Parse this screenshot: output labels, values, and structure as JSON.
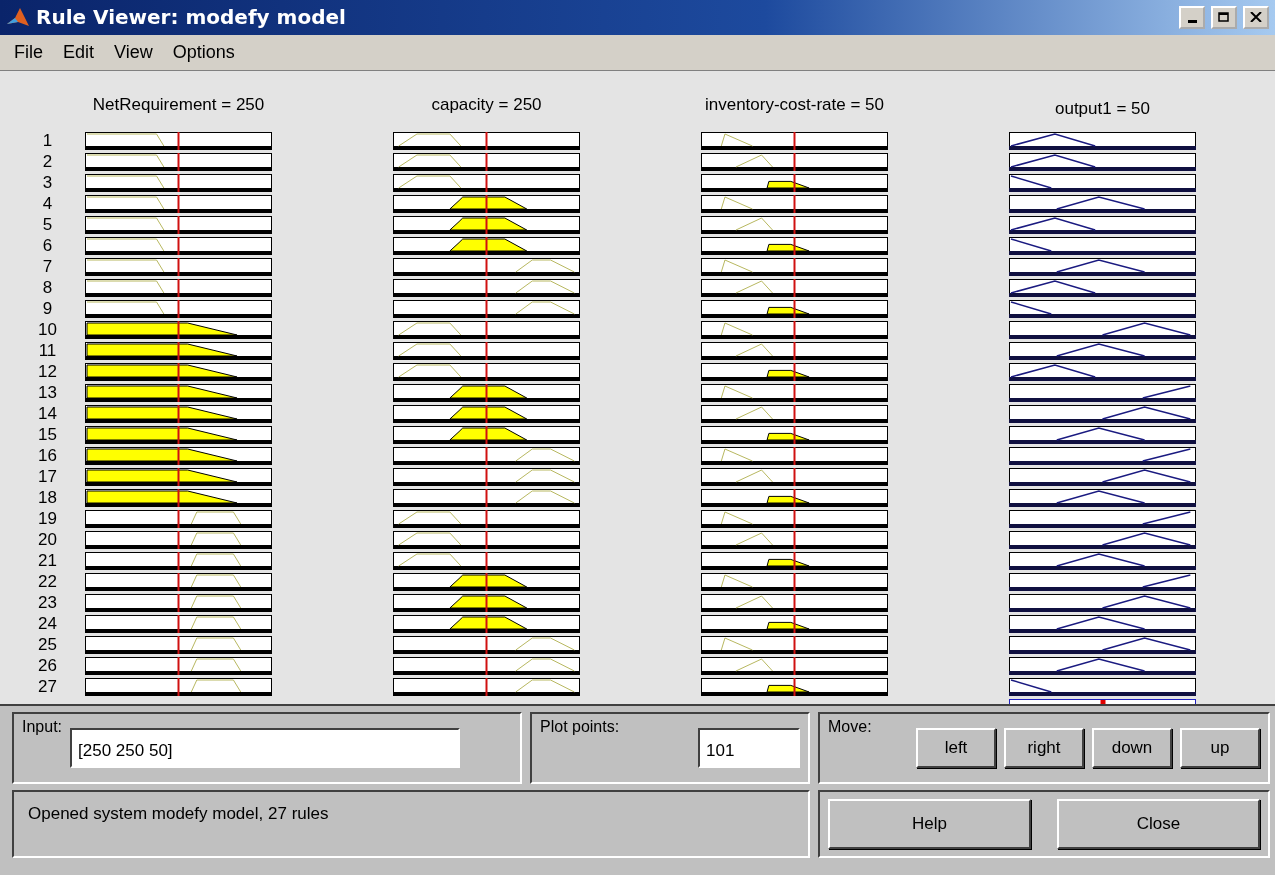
{
  "window": {
    "title": "Rule Viewer: modefy model"
  },
  "menu": [
    "File",
    "Edit",
    "View",
    "Options"
  ],
  "variables": [
    {
      "label": "NetRequirement = 250",
      "kind": "input"
    },
    {
      "label": "capacity = 250",
      "kind": "input"
    },
    {
      "label": "inventory-cost-rate = 50",
      "kind": "input"
    },
    {
      "label": "output1 = 50",
      "kind": "output"
    }
  ],
  "rules": [
    {
      "number": "1",
      "cells": [
        {
          "kind": "low",
          "fired": false
        },
        {
          "kind": "low",
          "fired": false
        },
        {
          "kind": "low",
          "fired": false
        },
        {
          "kind": "low"
        }
      ]
    },
    {
      "number": "2",
      "cells": [
        {
          "kind": "low",
          "fired": false
        },
        {
          "kind": "low",
          "fired": false
        },
        {
          "kind": "mid",
          "fired": false
        },
        {
          "kind": "low"
        }
      ]
    },
    {
      "number": "3",
      "cells": [
        {
          "kind": "low",
          "fired": false
        },
        {
          "kind": "low",
          "fired": false
        },
        {
          "kind": "high",
          "fired": true
        },
        {
          "kind": "vlow"
        }
      ]
    },
    {
      "number": "4",
      "cells": [
        {
          "kind": "low",
          "fired": false
        },
        {
          "kind": "mid",
          "fired": true
        },
        {
          "kind": "low",
          "fired": false
        },
        {
          "kind": "mid"
        }
      ]
    },
    {
      "number": "5",
      "cells": [
        {
          "kind": "low",
          "fired": false
        },
        {
          "kind": "mid",
          "fired": true
        },
        {
          "kind": "mid",
          "fired": false
        },
        {
          "kind": "low"
        }
      ]
    },
    {
      "number": "6",
      "cells": [
        {
          "kind": "low",
          "fired": false
        },
        {
          "kind": "mid",
          "fired": true
        },
        {
          "kind": "high",
          "fired": true
        },
        {
          "kind": "vlow"
        }
      ]
    },
    {
      "number": "7",
      "cells": [
        {
          "kind": "low",
          "fired": false
        },
        {
          "kind": "high",
          "fired": false
        },
        {
          "kind": "low",
          "fired": false
        },
        {
          "kind": "mid"
        }
      ]
    },
    {
      "number": "8",
      "cells": [
        {
          "kind": "low",
          "fired": false
        },
        {
          "kind": "high",
          "fired": false
        },
        {
          "kind": "mid",
          "fired": false
        },
        {
          "kind": "low"
        }
      ]
    },
    {
      "number": "9",
      "cells": [
        {
          "kind": "low",
          "fired": false
        },
        {
          "kind": "high",
          "fired": false
        },
        {
          "kind": "high",
          "fired": true
        },
        {
          "kind": "vlow"
        }
      ]
    },
    {
      "number": "10",
      "cells": [
        {
          "kind": "mid",
          "fired": true
        },
        {
          "kind": "low",
          "fired": false
        },
        {
          "kind": "low",
          "fired": false
        },
        {
          "kind": "high"
        }
      ]
    },
    {
      "number": "11",
      "cells": [
        {
          "kind": "mid",
          "fired": true
        },
        {
          "kind": "low",
          "fired": false
        },
        {
          "kind": "mid",
          "fired": false
        },
        {
          "kind": "mid"
        }
      ]
    },
    {
      "number": "12",
      "cells": [
        {
          "kind": "mid",
          "fired": true
        },
        {
          "kind": "low",
          "fired": false
        },
        {
          "kind": "high",
          "fired": true
        },
        {
          "kind": "low"
        }
      ]
    },
    {
      "number": "13",
      "cells": [
        {
          "kind": "mid",
          "fired": true
        },
        {
          "kind": "mid",
          "fired": true
        },
        {
          "kind": "low",
          "fired": false
        },
        {
          "kind": "vhigh"
        }
      ]
    },
    {
      "number": "14",
      "cells": [
        {
          "kind": "mid",
          "fired": true
        },
        {
          "kind": "mid",
          "fired": true
        },
        {
          "kind": "mid",
          "fired": false
        },
        {
          "kind": "high"
        }
      ]
    },
    {
      "number": "15",
      "cells": [
        {
          "kind": "mid",
          "fired": true
        },
        {
          "kind": "mid",
          "fired": true
        },
        {
          "kind": "high",
          "fired": true
        },
        {
          "kind": "mid"
        }
      ]
    },
    {
      "number": "16",
      "cells": [
        {
          "kind": "mid",
          "fired": true
        },
        {
          "kind": "high",
          "fired": false
        },
        {
          "kind": "low",
          "fired": false
        },
        {
          "kind": "vhigh"
        }
      ]
    },
    {
      "number": "17",
      "cells": [
        {
          "kind": "mid",
          "fired": true
        },
        {
          "kind": "high",
          "fired": false
        },
        {
          "kind": "mid",
          "fired": false
        },
        {
          "kind": "high"
        }
      ]
    },
    {
      "number": "18",
      "cells": [
        {
          "kind": "mid",
          "fired": true
        },
        {
          "kind": "high",
          "fired": false
        },
        {
          "kind": "high",
          "fired": true
        },
        {
          "kind": "mid"
        }
      ]
    },
    {
      "number": "19",
      "cells": [
        {
          "kind": "high",
          "fired": false
        },
        {
          "kind": "low",
          "fired": false
        },
        {
          "kind": "low",
          "fired": false
        },
        {
          "kind": "vhigh"
        }
      ]
    },
    {
      "number": "20",
      "cells": [
        {
          "kind": "high",
          "fired": false
        },
        {
          "kind": "low",
          "fired": false
        },
        {
          "kind": "mid",
          "fired": false
        },
        {
          "kind": "high"
        }
      ]
    },
    {
      "number": "21",
      "cells": [
        {
          "kind": "high",
          "fired": false
        },
        {
          "kind": "low",
          "fired": false
        },
        {
          "kind": "high",
          "fired": true
        },
        {
          "kind": "mid"
        }
      ]
    },
    {
      "number": "22",
      "cells": [
        {
          "kind": "high",
          "fired": false
        },
        {
          "kind": "mid",
          "fired": true
        },
        {
          "kind": "low",
          "fired": false
        },
        {
          "kind": "vhigh"
        }
      ]
    },
    {
      "number": "23",
      "cells": [
        {
          "kind": "high",
          "fired": false
        },
        {
          "kind": "mid",
          "fired": true
        },
        {
          "kind": "mid",
          "fired": false
        },
        {
          "kind": "high"
        }
      ]
    },
    {
      "number": "24",
      "cells": [
        {
          "kind": "high",
          "fired": false
        },
        {
          "kind": "mid",
          "fired": true
        },
        {
          "kind": "high",
          "fired": true
        },
        {
          "kind": "mid"
        }
      ]
    },
    {
      "number": "25",
      "cells": [
        {
          "kind": "high",
          "fired": false
        },
        {
          "kind": "high",
          "fired": false
        },
        {
          "kind": "low",
          "fired": false
        },
        {
          "kind": "high"
        }
      ]
    },
    {
      "number": "26",
      "cells": [
        {
          "kind": "high",
          "fired": false
        },
        {
          "kind": "high",
          "fired": false
        },
        {
          "kind": "mid",
          "fired": false
        },
        {
          "kind": "mid"
        }
      ]
    },
    {
      "number": "27",
      "cells": [
        {
          "kind": "high",
          "fired": false
        },
        {
          "kind": "high",
          "fired": false
        },
        {
          "kind": "high",
          "fired": true
        },
        {
          "kind": "vlow"
        }
      ]
    }
  ],
  "input": {
    "label": "Input:",
    "value": "[250 250 50]"
  },
  "plot_points": {
    "label": "Plot points:",
    "value": "101"
  },
  "move": {
    "label": "Move:",
    "buttons": [
      "left",
      "right",
      "down",
      "up"
    ]
  },
  "status": "Opened system modefy model, 27 rules",
  "buttons": [
    "Help",
    "Close"
  ]
}
